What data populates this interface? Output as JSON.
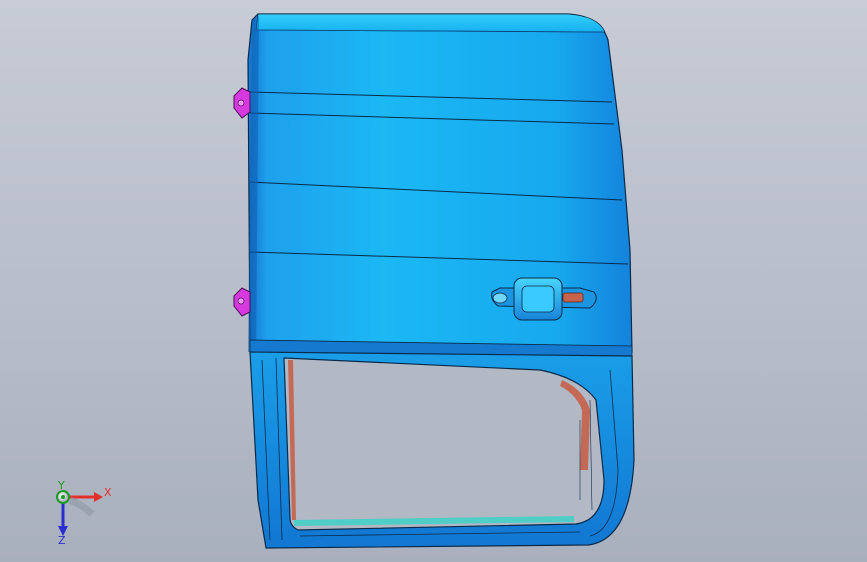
{
  "viewport": {
    "model": "door-panel",
    "colors": {
      "background_top": "#c7ccd6",
      "background_bottom": "#a9b0bd",
      "panel_main": "#19b7f2",
      "panel_shade": "#1a86d6",
      "panel_dark": "#0f5fae",
      "edge": "#0b2a4a",
      "hinge": "#d63adf",
      "inner_trim": "#c7614b"
    }
  },
  "triad": {
    "x_label": "X",
    "y_label": "Y",
    "z_label": "Z"
  }
}
